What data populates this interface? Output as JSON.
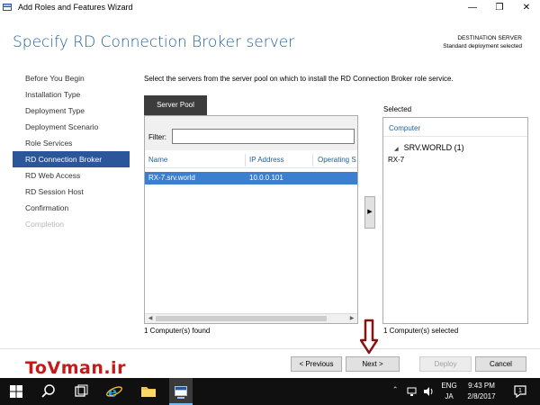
{
  "window": {
    "title": "Add Roles and Features Wizard",
    "min_glyph": "—",
    "max_glyph": "❐",
    "close_glyph": "✕"
  },
  "header": {
    "title": "Specify RD Connection Broker server",
    "destination_label": "DESTINATION SERVER",
    "destination_value": "Standard deployment selected"
  },
  "nav": {
    "items": [
      {
        "label": "Before You Begin",
        "state": "normal"
      },
      {
        "label": "Installation Type",
        "state": "normal"
      },
      {
        "label": "Deployment Type",
        "state": "normal"
      },
      {
        "label": "Deployment Scenario",
        "state": "normal"
      },
      {
        "label": "Role Services",
        "state": "normal"
      },
      {
        "label": "RD Connection Broker",
        "state": "active"
      },
      {
        "label": "RD Web Access",
        "state": "normal"
      },
      {
        "label": "RD Session Host",
        "state": "normal"
      },
      {
        "label": "Confirmation",
        "state": "normal"
      },
      {
        "label": "Completion",
        "state": "disabled"
      }
    ]
  },
  "main": {
    "instruction": "Select the servers from the server pool on which to install the RD Connection Broker role service.",
    "tab_label": "Server Pool",
    "filter_label": "Filter:",
    "filter_value": "",
    "columns": [
      "Name",
      "IP Address",
      "Operating S"
    ],
    "rows": [
      {
        "name": "RX-7.srv.world",
        "ip": "10.0.0.101",
        "os": ""
      }
    ],
    "found_text": "1 Computer(s) found",
    "move_glyph": "▶"
  },
  "selected": {
    "label": "Selected",
    "column": "Computer",
    "group": "SRV.WORLD (1)",
    "group_glyph": "◢",
    "items": [
      "RX-7"
    ],
    "count_text": "1 Computer(s) selected"
  },
  "buttons": {
    "previous": "< Previous",
    "next": "Next >",
    "deploy": "Deploy",
    "cancel": "Cancel"
  },
  "watermark": "ToVman.ir",
  "taskbar": {
    "lang_top": "ENG",
    "lang_bottom": "JA",
    "time": "9:43 PM",
    "date": "2/8/2017",
    "notification_count": "1"
  },
  "colors": {
    "accent": "#2b579a",
    "title_blue": "#1f5f9b",
    "selection": "#3c7fd1",
    "watermark": "#c41a1a"
  }
}
